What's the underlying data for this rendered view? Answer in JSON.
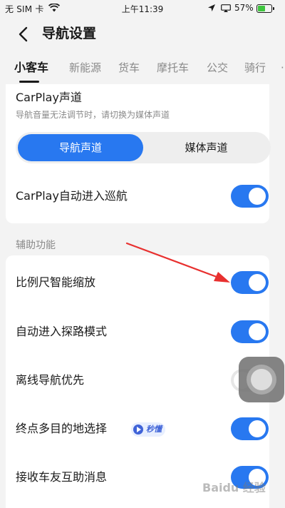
{
  "status_bar": {
    "carrier": "无 SIM 卡",
    "time": "上午11:39",
    "battery_percent": "57%",
    "battery_level": 0.57,
    "battery_color": "#3ec63e"
  },
  "header": {
    "back_icon": "chevron-left-icon",
    "title": "导航设置"
  },
  "tabs": [
    {
      "label": "小客车",
      "active": true
    },
    {
      "label": "新能源",
      "active": false
    },
    {
      "label": "货车",
      "active": false
    },
    {
      "label": "摩托车",
      "active": false
    },
    {
      "label": "公交",
      "active": false
    },
    {
      "label": "骑行",
      "active": false
    }
  ],
  "carplay_card": {
    "channel_title": "CarPlay声道",
    "channel_desc": "导航音量无法调节时，请切换为媒体声道",
    "options": [
      {
        "label": "导航声道",
        "selected": true
      },
      {
        "label": "媒体声道",
        "selected": false
      }
    ],
    "auto_cruise_label": "CarPlay自动进入巡航",
    "auto_cruise_on": true
  },
  "assist_section": {
    "header": "辅助功能",
    "items": [
      {
        "label": "比例尺智能缩放",
        "on": true
      },
      {
        "label": "自动进入探路模式",
        "on": true
      },
      {
        "label": "离线导航优先",
        "on": false
      },
      {
        "label": "终点多目的地选择",
        "on": true,
        "badge": "秒懂"
      },
      {
        "label": "接收车友互助消息",
        "on": true
      }
    ]
  },
  "colors": {
    "accent": "#2878f0",
    "annotation_arrow": "#e8302f",
    "background": "#f3f3f3"
  },
  "watermark": "Baidu 经验"
}
